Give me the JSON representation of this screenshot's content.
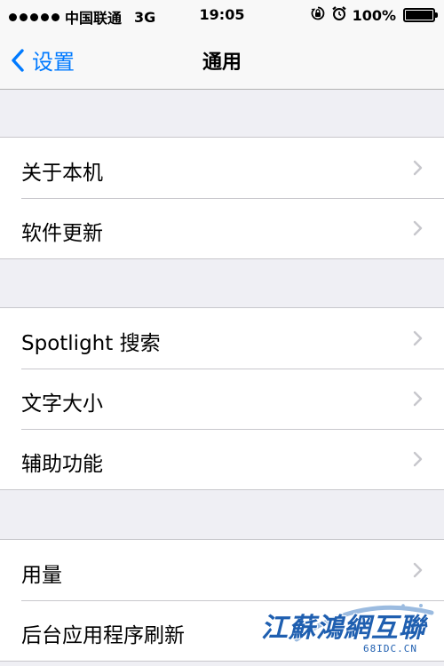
{
  "status_bar": {
    "carrier": "中国联通",
    "network": "3G",
    "time": "19:05",
    "battery": "100%",
    "battery_level": 1.0
  },
  "nav": {
    "back_label": "设置",
    "title": "通用"
  },
  "groups": [
    {
      "items": [
        "关于本机",
        "软件更新"
      ]
    },
    {
      "items": [
        "Spotlight 搜索",
        "文字大小",
        "辅助功能"
      ]
    },
    {
      "items": [
        "用量",
        "后台应用程序刷新"
      ]
    }
  ],
  "watermark": {
    "text": "江蘇鴻網互聯",
    "sub": "68IDC.CN"
  },
  "colors": {
    "accent": "#007aff",
    "background": "#efeff4",
    "separator": "#c8c7cc",
    "chevron": "#c7c7cc"
  }
}
